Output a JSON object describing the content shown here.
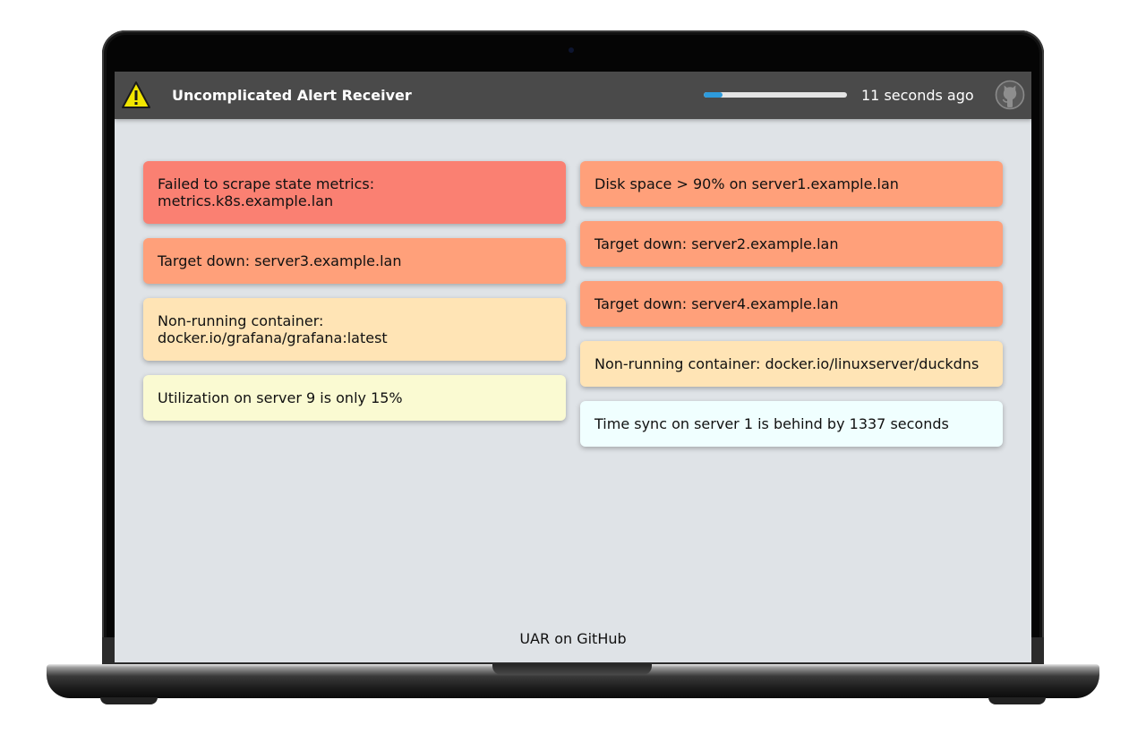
{
  "header": {
    "title": "Uncomplicated Alert Receiver",
    "last_updated": "11 seconds ago",
    "refresh_progress": 0.13,
    "logo_icon": "warning-triangle-icon",
    "github_icon": "github-icon"
  },
  "alert_colors": {
    "critical": "#fa8072",
    "error": "#ffa07a",
    "warning": "#ffe4b5",
    "info": "#fafad2",
    "none": "#f0ffff"
  },
  "columns": [
    {
      "alerts": [
        {
          "text": "Failed to scrape state metrics: metrics.k8s.example.lan",
          "severity": "critical"
        },
        {
          "text": "Target down: server3.example.lan",
          "severity": "error"
        },
        {
          "text": "Non-running container: docker.io/grafana/grafana:latest",
          "severity": "warning"
        },
        {
          "text": "Utilization on server 9 is only 15%",
          "severity": "info"
        }
      ]
    },
    {
      "alerts": [
        {
          "text": "Disk space > 90% on server1.example.lan",
          "severity": "error"
        },
        {
          "text": "Target down: server2.example.lan",
          "severity": "error"
        },
        {
          "text": "Target down: server4.example.lan",
          "severity": "error"
        },
        {
          "text": "Non-running container: docker.io/linuxserver/duckdns",
          "severity": "warning"
        },
        {
          "text": "Time sync on server 1 is behind by 1337 seconds",
          "severity": "none"
        }
      ]
    }
  ],
  "footer": {
    "link_text": "UAR on GitHub"
  }
}
